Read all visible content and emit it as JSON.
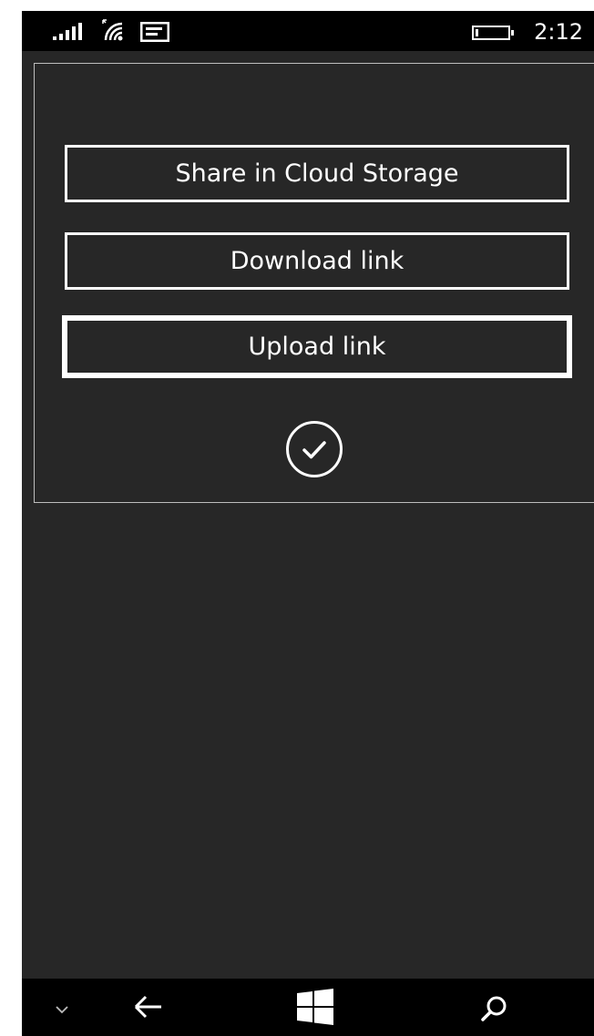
{
  "status_bar": {
    "time": "2:12",
    "icons": [
      "signal-icon",
      "wifi-icon",
      "message-icon",
      "battery-icon"
    ]
  },
  "dialog": {
    "buttons": [
      {
        "label": "Share in Cloud Storage"
      },
      {
        "label": "Download link"
      },
      {
        "label": "Upload link",
        "focused": true
      }
    ],
    "confirm_icon": "checkmark-circle-icon"
  },
  "nav_bar": {
    "icons": [
      "chevron-down-icon",
      "back-arrow-icon",
      "windows-start-icon",
      "search-icon"
    ]
  },
  "colors": {
    "background": "#272727",
    "bars": "#000000",
    "foreground": "#ffffff",
    "dialog_border": "#bdbdbd"
  }
}
